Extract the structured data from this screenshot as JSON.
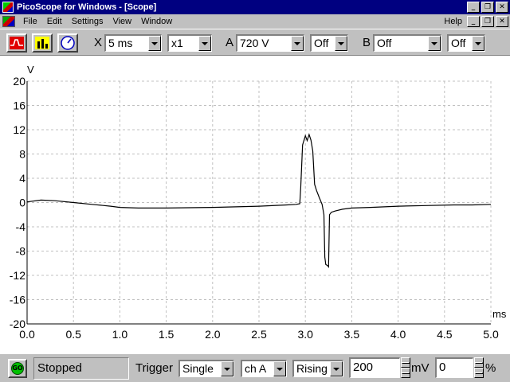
{
  "window": {
    "title": "PicoScope for Windows - [Scope]",
    "buttons": [
      "_",
      "❐",
      "✕"
    ]
  },
  "menubar": {
    "items": [
      "File",
      "Edit",
      "Settings",
      "View",
      "Window"
    ],
    "help": "Help",
    "doc_buttons": [
      "_",
      "❐",
      "✕"
    ]
  },
  "toolbar": {
    "timebase_label": "X",
    "timebase_value": "5 ms",
    "zoom_value": "x1",
    "channel_a_label": "A",
    "channel_a_range": "720 V",
    "channel_a_coupling": "Off",
    "channel_b_label": "B",
    "channel_b_range": "Off",
    "channel_b_coupling": "Off"
  },
  "statusbar": {
    "go_button": "GO",
    "status": "Stopped",
    "trigger_label": "Trigger",
    "trigger_mode": "Single",
    "trigger_channel": "ch A",
    "trigger_edge": "Rising",
    "trigger_level": "200",
    "trigger_level_unit": "mV",
    "pretrigger": "0",
    "pretrigger_unit": "%"
  },
  "chart_data": {
    "type": "line",
    "xlabel": "ms",
    "ylabel": "V",
    "xlim": [
      0.0,
      5.0
    ],
    "ylim": [
      -20,
      20
    ],
    "x_ticks": [
      "0.0",
      "0.5",
      "1.0",
      "1.5",
      "2.0",
      "2.5",
      "3.0",
      "3.5",
      "4.0",
      "4.5",
      "5.0"
    ],
    "y_ticks": [
      "20",
      "16",
      "12",
      "8",
      "4",
      "0",
      "-4",
      "-8",
      "-12",
      "-16",
      "-20"
    ],
    "grid": true,
    "series": [
      {
        "color": "#000000",
        "x": [
          0.0,
          0.15,
          0.3,
          0.5,
          0.7,
          0.9,
          1.0,
          1.2,
          1.5,
          2.0,
          2.5,
          2.8,
          2.9,
          2.94,
          2.95,
          2.97,
          3.0,
          3.02,
          3.04,
          3.06,
          3.08,
          3.1,
          3.12,
          3.15,
          3.18,
          3.2,
          3.21,
          3.22,
          3.24,
          3.25,
          3.26,
          3.28,
          3.32,
          3.4,
          3.5,
          3.7,
          4.0,
          4.3,
          4.6,
          4.8,
          5.0
        ],
        "y": [
          0.1,
          0.4,
          0.3,
          0.0,
          -0.3,
          -0.6,
          -0.8,
          -0.9,
          -0.9,
          -0.8,
          -0.6,
          -0.4,
          -0.3,
          -0.2,
          2.5,
          9.5,
          11.0,
          10.2,
          11.2,
          10.3,
          8.5,
          3.0,
          2.0,
          0.8,
          -0.3,
          -2.0,
          -9.0,
          -10.2,
          -10.4,
          -10.6,
          -2.0,
          -1.6,
          -1.4,
          -1.1,
          -0.9,
          -0.8,
          -0.6,
          -0.5,
          -0.4,
          -0.4,
          -0.3
        ]
      }
    ]
  }
}
